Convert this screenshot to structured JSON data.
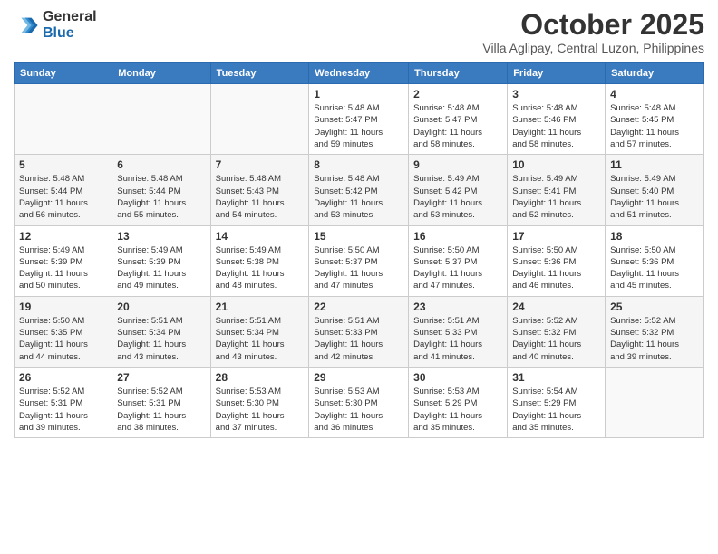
{
  "header": {
    "logo_general": "General",
    "logo_blue": "Blue",
    "month_title": "October 2025",
    "location": "Villa Aglipay, Central Luzon, Philippines"
  },
  "days_of_week": [
    "Sunday",
    "Monday",
    "Tuesday",
    "Wednesday",
    "Thursday",
    "Friday",
    "Saturday"
  ],
  "weeks": [
    [
      {
        "num": "",
        "info": ""
      },
      {
        "num": "",
        "info": ""
      },
      {
        "num": "",
        "info": ""
      },
      {
        "num": "1",
        "info": "Sunrise: 5:48 AM\nSunset: 5:47 PM\nDaylight: 11 hours\nand 59 minutes."
      },
      {
        "num": "2",
        "info": "Sunrise: 5:48 AM\nSunset: 5:47 PM\nDaylight: 11 hours\nand 58 minutes."
      },
      {
        "num": "3",
        "info": "Sunrise: 5:48 AM\nSunset: 5:46 PM\nDaylight: 11 hours\nand 58 minutes."
      },
      {
        "num": "4",
        "info": "Sunrise: 5:48 AM\nSunset: 5:45 PM\nDaylight: 11 hours\nand 57 minutes."
      }
    ],
    [
      {
        "num": "5",
        "info": "Sunrise: 5:48 AM\nSunset: 5:44 PM\nDaylight: 11 hours\nand 56 minutes."
      },
      {
        "num": "6",
        "info": "Sunrise: 5:48 AM\nSunset: 5:44 PM\nDaylight: 11 hours\nand 55 minutes."
      },
      {
        "num": "7",
        "info": "Sunrise: 5:48 AM\nSunset: 5:43 PM\nDaylight: 11 hours\nand 54 minutes."
      },
      {
        "num": "8",
        "info": "Sunrise: 5:48 AM\nSunset: 5:42 PM\nDaylight: 11 hours\nand 53 minutes."
      },
      {
        "num": "9",
        "info": "Sunrise: 5:49 AM\nSunset: 5:42 PM\nDaylight: 11 hours\nand 53 minutes."
      },
      {
        "num": "10",
        "info": "Sunrise: 5:49 AM\nSunset: 5:41 PM\nDaylight: 11 hours\nand 52 minutes."
      },
      {
        "num": "11",
        "info": "Sunrise: 5:49 AM\nSunset: 5:40 PM\nDaylight: 11 hours\nand 51 minutes."
      }
    ],
    [
      {
        "num": "12",
        "info": "Sunrise: 5:49 AM\nSunset: 5:39 PM\nDaylight: 11 hours\nand 50 minutes."
      },
      {
        "num": "13",
        "info": "Sunrise: 5:49 AM\nSunset: 5:39 PM\nDaylight: 11 hours\nand 49 minutes."
      },
      {
        "num": "14",
        "info": "Sunrise: 5:49 AM\nSunset: 5:38 PM\nDaylight: 11 hours\nand 48 minutes."
      },
      {
        "num": "15",
        "info": "Sunrise: 5:50 AM\nSunset: 5:37 PM\nDaylight: 11 hours\nand 47 minutes."
      },
      {
        "num": "16",
        "info": "Sunrise: 5:50 AM\nSunset: 5:37 PM\nDaylight: 11 hours\nand 47 minutes."
      },
      {
        "num": "17",
        "info": "Sunrise: 5:50 AM\nSunset: 5:36 PM\nDaylight: 11 hours\nand 46 minutes."
      },
      {
        "num": "18",
        "info": "Sunrise: 5:50 AM\nSunset: 5:36 PM\nDaylight: 11 hours\nand 45 minutes."
      }
    ],
    [
      {
        "num": "19",
        "info": "Sunrise: 5:50 AM\nSunset: 5:35 PM\nDaylight: 11 hours\nand 44 minutes."
      },
      {
        "num": "20",
        "info": "Sunrise: 5:51 AM\nSunset: 5:34 PM\nDaylight: 11 hours\nand 43 minutes."
      },
      {
        "num": "21",
        "info": "Sunrise: 5:51 AM\nSunset: 5:34 PM\nDaylight: 11 hours\nand 43 minutes."
      },
      {
        "num": "22",
        "info": "Sunrise: 5:51 AM\nSunset: 5:33 PM\nDaylight: 11 hours\nand 42 minutes."
      },
      {
        "num": "23",
        "info": "Sunrise: 5:51 AM\nSunset: 5:33 PM\nDaylight: 11 hours\nand 41 minutes."
      },
      {
        "num": "24",
        "info": "Sunrise: 5:52 AM\nSunset: 5:32 PM\nDaylight: 11 hours\nand 40 minutes."
      },
      {
        "num": "25",
        "info": "Sunrise: 5:52 AM\nSunset: 5:32 PM\nDaylight: 11 hours\nand 39 minutes."
      }
    ],
    [
      {
        "num": "26",
        "info": "Sunrise: 5:52 AM\nSunset: 5:31 PM\nDaylight: 11 hours\nand 39 minutes."
      },
      {
        "num": "27",
        "info": "Sunrise: 5:52 AM\nSunset: 5:31 PM\nDaylight: 11 hours\nand 38 minutes."
      },
      {
        "num": "28",
        "info": "Sunrise: 5:53 AM\nSunset: 5:30 PM\nDaylight: 11 hours\nand 37 minutes."
      },
      {
        "num": "29",
        "info": "Sunrise: 5:53 AM\nSunset: 5:30 PM\nDaylight: 11 hours\nand 36 minutes."
      },
      {
        "num": "30",
        "info": "Sunrise: 5:53 AM\nSunset: 5:29 PM\nDaylight: 11 hours\nand 35 minutes."
      },
      {
        "num": "31",
        "info": "Sunrise: 5:54 AM\nSunset: 5:29 PM\nDaylight: 11 hours\nand 35 minutes."
      },
      {
        "num": "",
        "info": ""
      }
    ]
  ]
}
